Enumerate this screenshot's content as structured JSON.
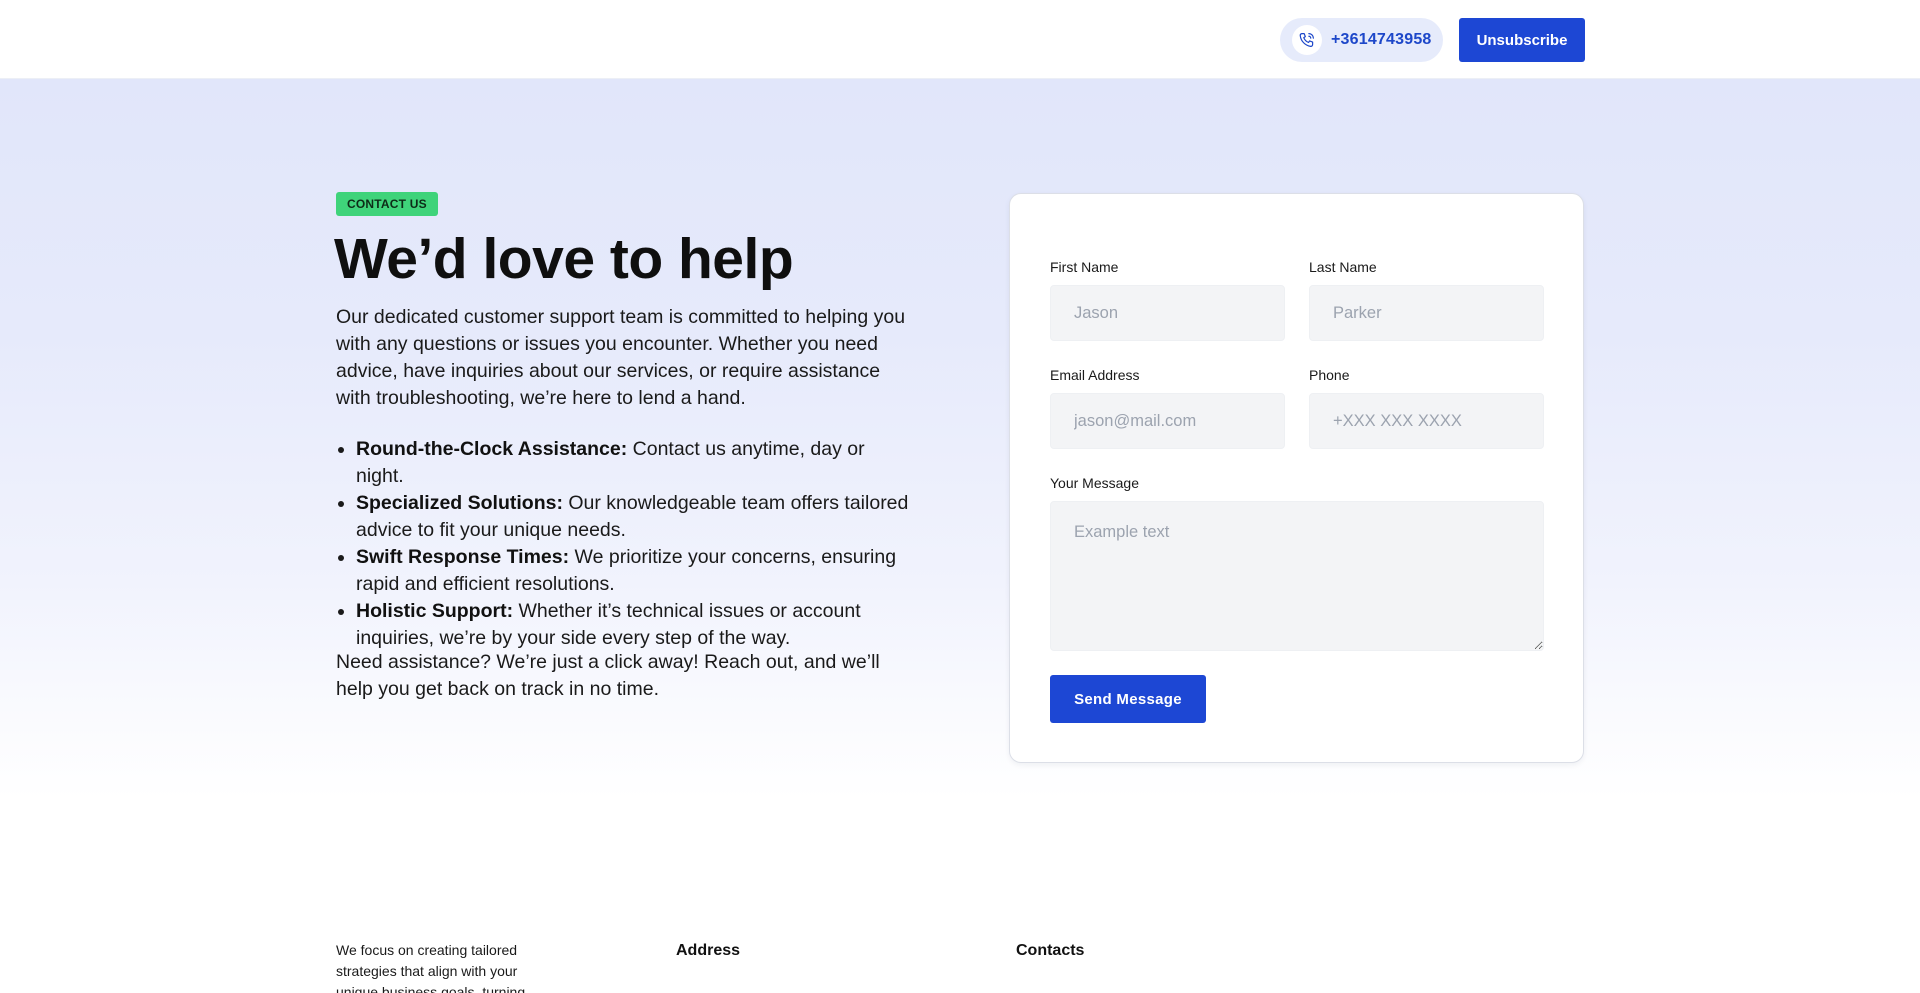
{
  "header": {
    "phone_number": "+3614743958",
    "phone_icon": "phone-icon",
    "unsubscribe_label": "Unsubscribe",
    "accent_color": "#1d47d4"
  },
  "hero": {
    "badge": "CONTACT US",
    "badge_color": "#3fd37a",
    "title": "We’d love to help",
    "intro": "Our dedicated customer support team is committed to helping you with any questions or issues you encounter. Whether you need advice, have inquiries about our services, or require assistance with troubleshooting, we’re here to lend a hand.",
    "features": [
      {
        "title": "Round-the-Clock Assistance:",
        "text": " Contact us anytime, day or night."
      },
      {
        "title": "Specialized Solutions:",
        "text": " Our knowledgeable team offers tailored advice to fit your unique needs."
      },
      {
        "title": "Swift Response Times:",
        "text": " We prioritize your concerns, ensuring rapid and efficient resolutions."
      },
      {
        "title": "Holistic Support:",
        "text": " Whether it’s technical issues or account inquiries, we’re by your side every step of the way."
      }
    ],
    "outro": "Need assistance? We’re just a click away! Reach out, and we’ll help you get back on track in no time."
  },
  "form": {
    "first_name": {
      "label": "First Name",
      "placeholder": "Jason",
      "value": ""
    },
    "last_name": {
      "label": "Last Name",
      "placeholder": "Parker",
      "value": ""
    },
    "email": {
      "label": "Email Address",
      "placeholder": "jason@mail.com",
      "value": ""
    },
    "phone": {
      "label": "Phone",
      "placeholder": "+XXX XXX XXXX",
      "value": ""
    },
    "message": {
      "label": "Your Message",
      "placeholder": "Example text",
      "value": ""
    },
    "submit_label": "Send Message"
  },
  "footer": {
    "about": "We focus on creating tailored strategies that align with your unique business goals, turning",
    "address_heading": "Address",
    "contacts_heading": "Contacts"
  }
}
